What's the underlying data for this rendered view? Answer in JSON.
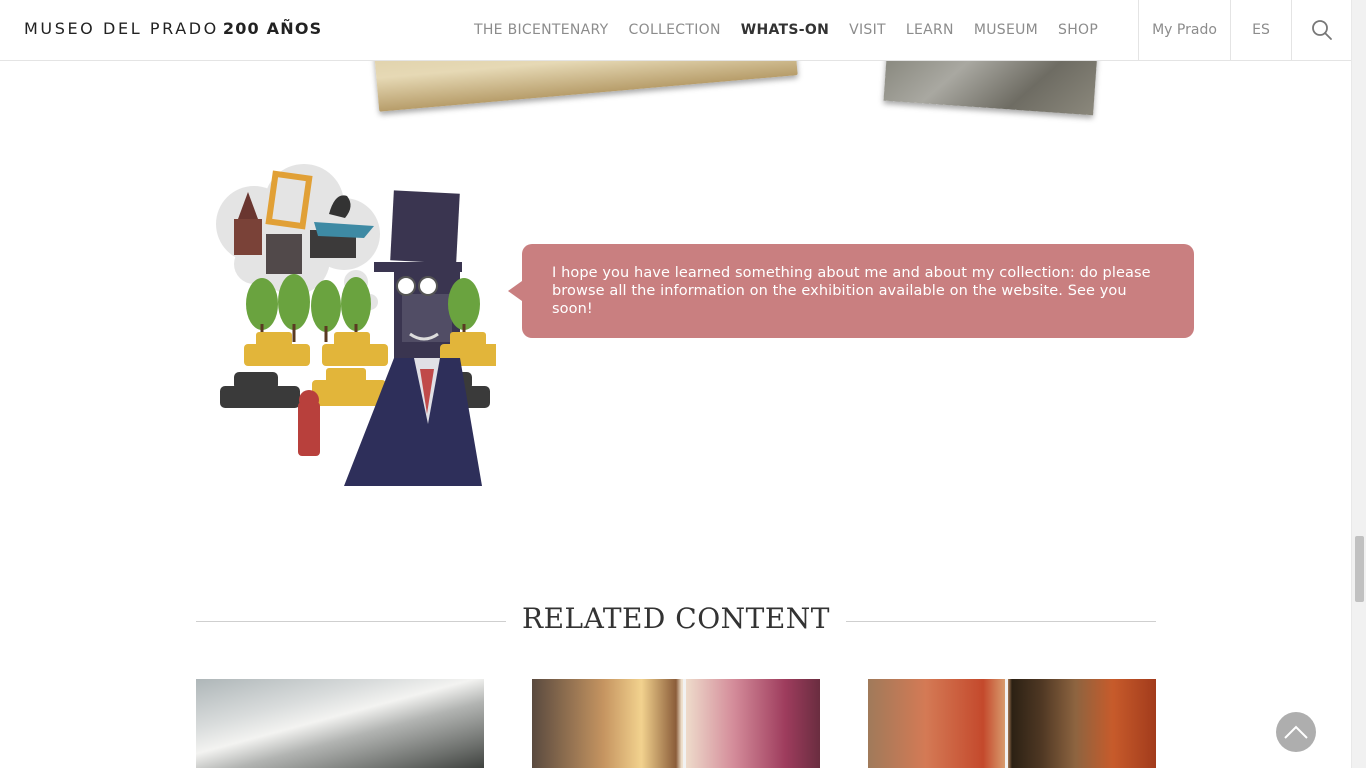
{
  "header": {
    "logo_text": "MUSEO DEL PRADO",
    "logo_bold": "200 AÑOS",
    "nav": [
      {
        "label": "THE BICENTENARY",
        "active": false
      },
      {
        "label": "COLLECTION",
        "active": false
      },
      {
        "label": "WHATS-ON",
        "active": true
      },
      {
        "label": "VISIT",
        "active": false
      },
      {
        "label": "LEARN",
        "active": false
      },
      {
        "label": "MUSEUM",
        "active": false
      },
      {
        "label": "SHOP",
        "active": false
      }
    ],
    "my_prado": "My Prado",
    "language": "ES",
    "search_icon": "search-icon"
  },
  "bubble": {
    "text": "I hope you have learned something about me and about my collection: do please browse all the information on the exhibition available on the website. See you soon!",
    "color": "#c97f80"
  },
  "related": {
    "title": "RELATED CONTENT",
    "cards": [
      {
        "icon": "snowy-landscape-painting"
      },
      {
        "icon": "cherub-painting-detail"
      },
      {
        "icon": "saint-painting-detail"
      }
    ]
  },
  "back_to_top_icon": "chevron-up-icon"
}
